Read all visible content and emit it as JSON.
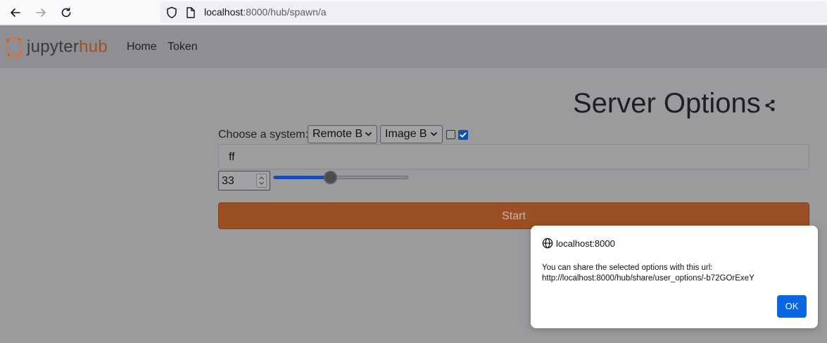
{
  "browser": {
    "url_host": "localhost",
    "url_rest": ":8000/hub/spawn/a"
  },
  "hub_nav": {
    "logo_part1": "jupyter",
    "logo_part2": "hub",
    "links": [
      "Home",
      "Token"
    ]
  },
  "page": {
    "title": "Server Options",
    "choose_label": "Choose a system:",
    "select_system": "Remote B",
    "select_image": "Image B",
    "checkbox1_checked": false,
    "checkbox2_checked": true,
    "text_value": "ff",
    "number_value": "33",
    "slider_value_percent": 42,
    "start_label": "Start"
  },
  "dialog": {
    "host": "localhost:8000",
    "message_line1": "You can share the selected options with this url:",
    "message_line2": "http://localhost:8000/hub/share/user_options/-b72GOrExeY",
    "ok_label": "OK"
  },
  "colors": {
    "accent_orange": "#a0521d",
    "ok_blue": "#0a65e0"
  }
}
